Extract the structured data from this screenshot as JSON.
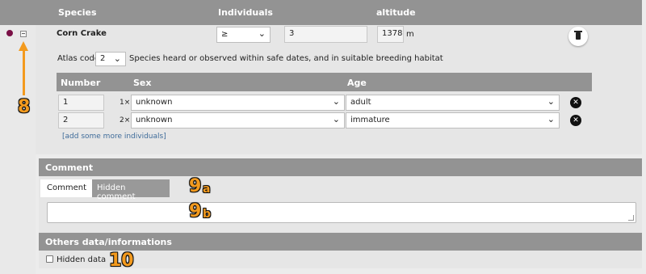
{
  "header": {
    "species_label": "Species",
    "individuals_label": "Individuals",
    "altitude_label": "altitude"
  },
  "observation": {
    "species_name": "Corn Crake",
    "operator": "≥",
    "count": "3",
    "altitude": "1378",
    "altitude_unit": "m",
    "atlas_code_label": "Atlas code",
    "atlas_code": "2",
    "atlas_description": "Species heard or observed within safe dates, and in suitable breeding habitat"
  },
  "details_table": {
    "columns": [
      "Number",
      "Sex",
      "Age"
    ],
    "rows": [
      {
        "number": "1",
        "multiplier": "1×",
        "sex": "unknown",
        "age": "adult"
      },
      {
        "number": "2",
        "multiplier": "2×",
        "sex": "unknown",
        "age": "immature"
      }
    ],
    "add_link": "[add some more individuals]"
  },
  "comment": {
    "section_title": "Comment",
    "tab_comment": "Comment",
    "tab_hidden_comment": "Hidden comment",
    "value": ""
  },
  "others": {
    "section_title": "Others data/informations",
    "hidden_data_label": "Hidden data",
    "hidden_data_checked": false
  },
  "annotations": {
    "a8": "8",
    "a9a_num": "9",
    "a9a_letter": "a",
    "a9b_num": "9",
    "a9b_letter": "b",
    "a10": "10"
  },
  "colors": {
    "header_bg": "#939393",
    "panel_bg": "#e6e6e6",
    "annotation": "#f39a1e",
    "link": "#3f6c9a",
    "species_dot": "#7a1046"
  }
}
